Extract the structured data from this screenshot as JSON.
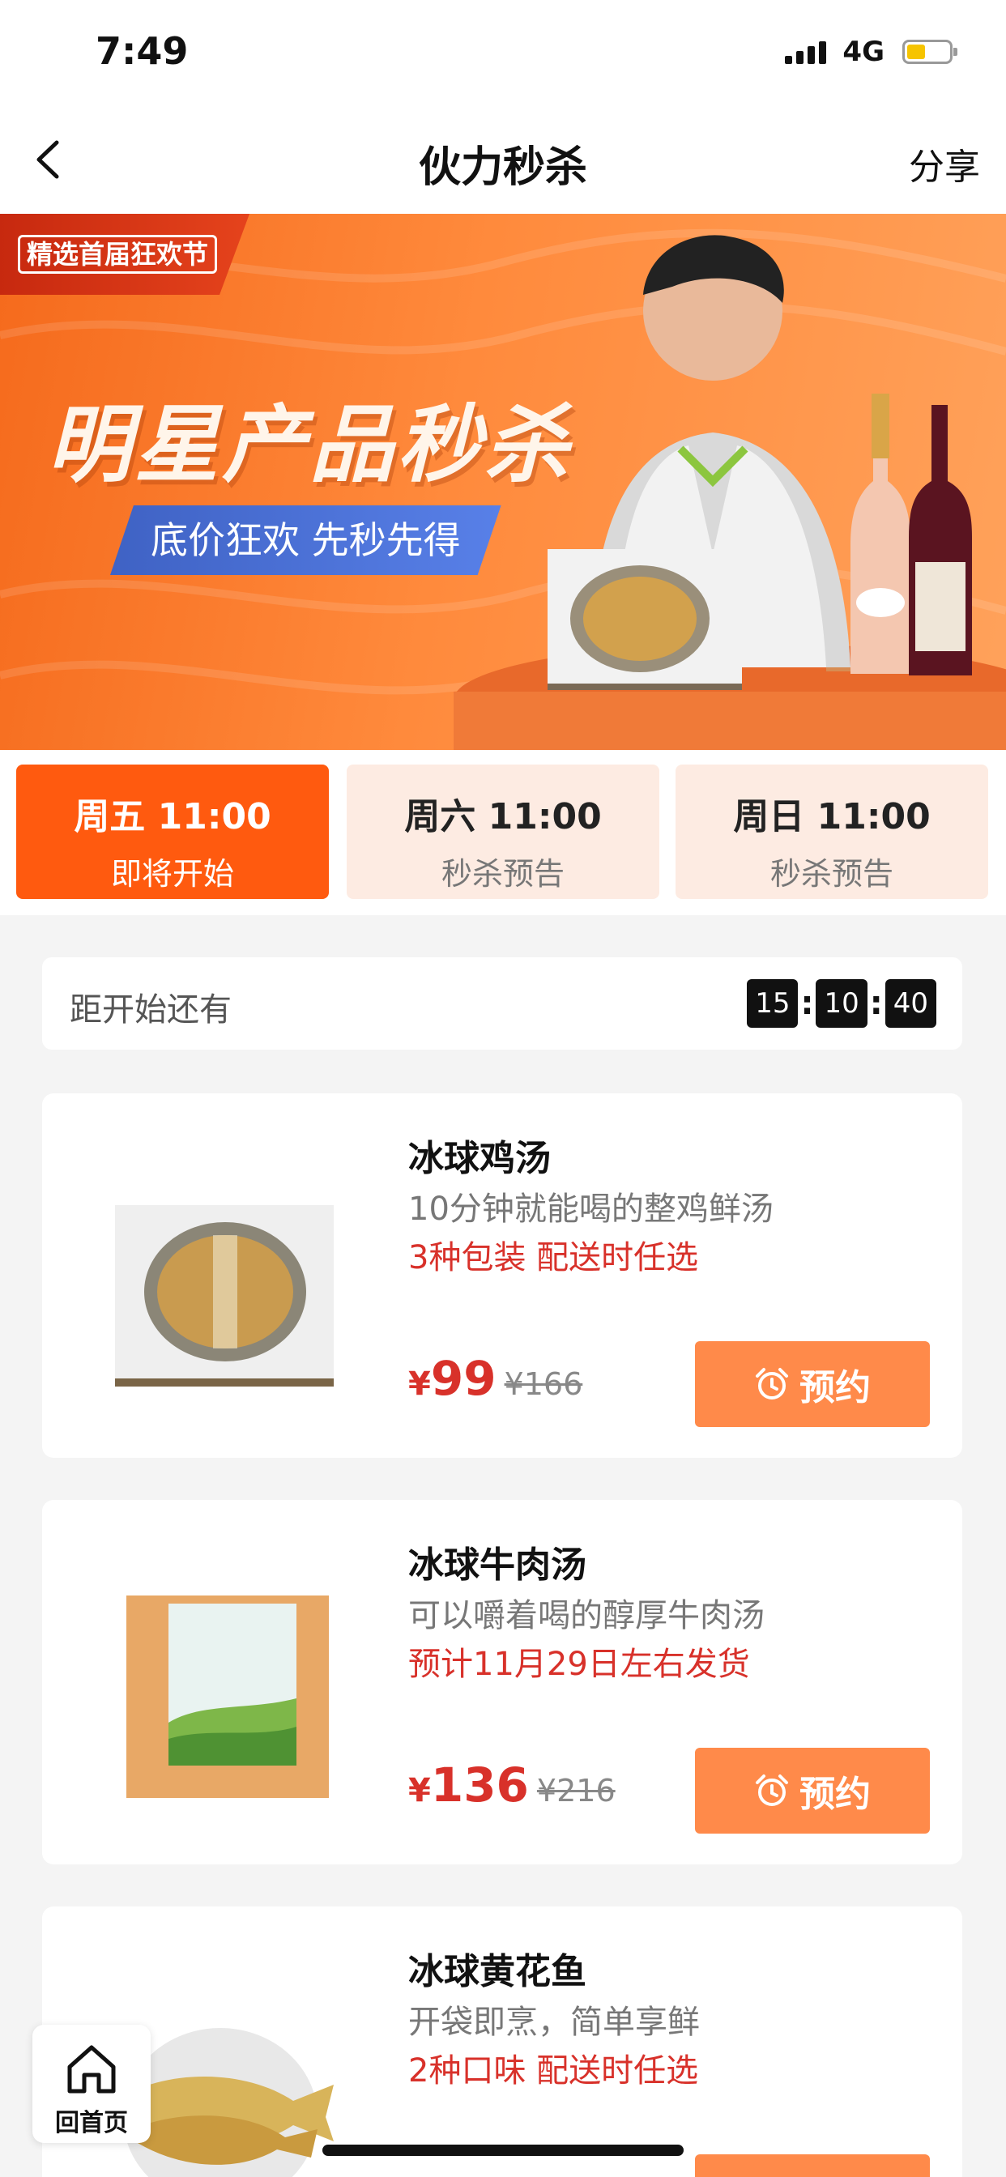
{
  "status_bar": {
    "time": "7:49",
    "network": "4G"
  },
  "nav": {
    "title": "伙力秒杀",
    "share_label": "分享"
  },
  "banner": {
    "tag": "精选首届狂欢节",
    "title": "明星产品秒杀",
    "subtitle": "底价狂欢 先秒先得"
  },
  "tabs": [
    {
      "time": "周五 11:00",
      "status": "即将开始",
      "active": true
    },
    {
      "time": "周六 11:00",
      "status": "秒杀预告",
      "active": false
    },
    {
      "time": "周日 11:00",
      "status": "秒杀预告",
      "active": false
    }
  ],
  "countdown": {
    "label": "距开始还有",
    "hours": "15",
    "minutes": "10",
    "seconds": "40"
  },
  "products": [
    {
      "name": "冰球鸡汤",
      "desc": "10分钟就能喝的整鸡鲜汤",
      "note": "3种包装 配送时任选",
      "currency": "¥",
      "price": "99",
      "original_price": "¥166",
      "button": "预约"
    },
    {
      "name": "冰球牛肉汤",
      "desc": "可以嚼着喝的醇厚牛肉汤",
      "note": "预计11月29日左右发货",
      "currency": "¥",
      "price": "136",
      "original_price": "¥216",
      "button": "预约"
    },
    {
      "name": "冰球黄花鱼",
      "desc": "开袋即烹，简单享鲜",
      "note": "2种口味 配送时任选"
    }
  ],
  "home_float": {
    "label": "回首页"
  },
  "colors": {
    "accent": "#ff5a0f",
    "price_red": "#d8312a",
    "button": "#ff8a4a"
  }
}
